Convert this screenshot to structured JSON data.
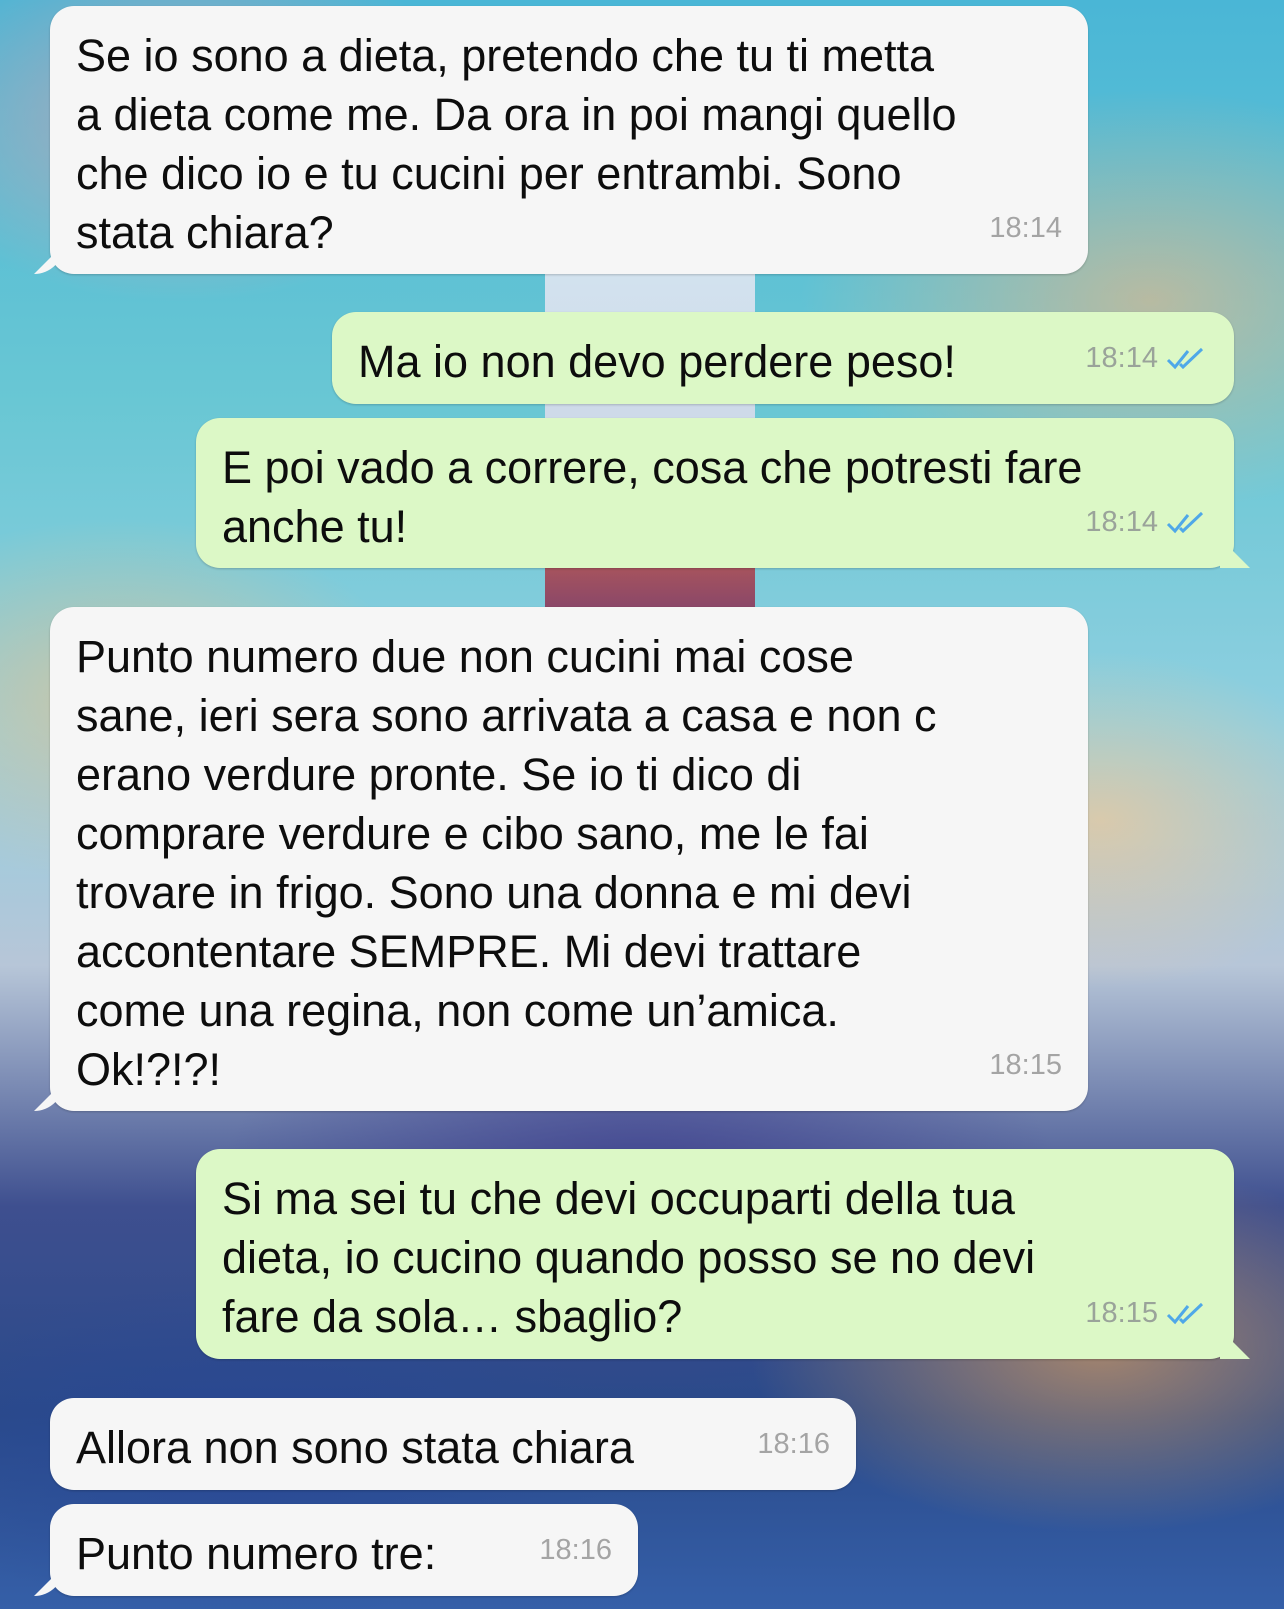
{
  "messages": [
    {
      "direction": "in",
      "text": "Se io sono a dieta, pretendo che tu ti metta\na dieta come me. Da ora in poi mangi quello\nche dico io e tu cucini per entrambi. Sono\nstata chiara?",
      "time": "18:14"
    },
    {
      "direction": "out",
      "text": "Ma io non devo perdere peso!",
      "time": "18:14"
    },
    {
      "direction": "out",
      "text": "E poi vado a correre, cosa che potresti fare\nanche tu!",
      "time": "18:14"
    },
    {
      "direction": "in",
      "text": "Punto numero due non cucini mai cose\nsane, ieri sera sono arrivata a casa e non c\nerano verdure pronte. Se io ti dico di\ncomprare verdure e cibo sano, me le fai\ntrovare in frigo. Sono una donna e mi devi\naccontentare SEMPRE. Mi devi trattare\ncome una regina, non come un’amica.\nOk!?!?!",
      "time": "18:15"
    },
    {
      "direction": "out",
      "text": "Si ma sei tu che devi occuparti della tua\ndieta, io cucino quando posso se no devi\nfare da sola… sbaglio?",
      "time": "18:15"
    },
    {
      "direction": "in",
      "text": "Allora non sono stata chiara",
      "time": "18:16"
    },
    {
      "direction": "in",
      "text": "Punto numero tre:",
      "time": "18:16"
    }
  ],
  "colors": {
    "incoming_bubble": "#f6f6f6",
    "outgoing_bubble": "#dcf8c6",
    "read_receipt": "#4fa8e8"
  },
  "icons": {
    "read_receipt": "double-check-icon"
  }
}
